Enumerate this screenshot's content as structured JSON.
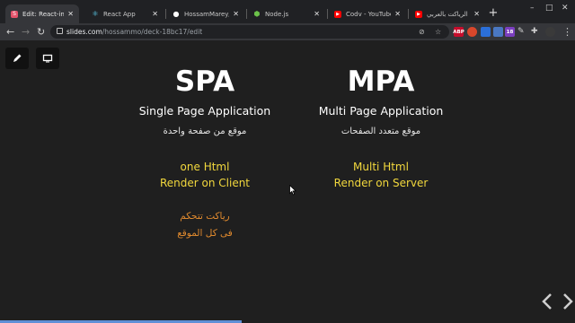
{
  "browser": {
    "tabs": [
      {
        "title": "Edit: React-introdu",
        "favicon": "S",
        "favicon_color": "#e4526a",
        "active": true
      },
      {
        "title": "React App",
        "favicon": "⚛",
        "favicon_color": "#61dafb",
        "active": false
      },
      {
        "title": "HossamMarey/rea",
        "favicon": "●",
        "favicon_color": "#ffffff",
        "active": false
      },
      {
        "title": "Node.js",
        "favicon": "⬢",
        "favicon_color": "#6cc24a",
        "active": false
      },
      {
        "title": "Codv - YouTube",
        "favicon": "▶",
        "favicon_color": "#ff0000",
        "active": false
      },
      {
        "title": "تعلم الرياكت بالعربي",
        "favicon": "▶",
        "favicon_color": "#ff0000",
        "active": false
      }
    ],
    "url_host": "slides.com",
    "url_path": "/hossammo/deck-18bc17/edit",
    "extensions": [
      {
        "label": "ABP",
        "color": "#c70d2c"
      },
      {
        "label": "",
        "color": "#d9472b"
      },
      {
        "label": "",
        "color": "#2b6fd9"
      },
      {
        "label": "",
        "color": "#4a78c2"
      },
      {
        "label": "18",
        "color": "#7b3fbf"
      }
    ]
  },
  "slide": {
    "left": {
      "heading": "SPA",
      "subtitle": "Single Page Application",
      "arabic": "موقع من صفحة واحدة",
      "line1": "one Html",
      "line2": "Render on Client",
      "note1": "رياكت تتحكم",
      "note2": "فى كل الموقع"
    },
    "right": {
      "heading": "MPA",
      "subtitle": "Multi Page Application",
      "arabic": "موقع متعدد الصفحات",
      "line1": "Multi Html",
      "line2": "Render on Server"
    },
    "progress": 0.42
  },
  "colors": {
    "heading": "#ffffff",
    "highlight_yellow": "#f2d83d",
    "highlight_orange": "#e08a2e",
    "background": "#1f1f1f"
  }
}
